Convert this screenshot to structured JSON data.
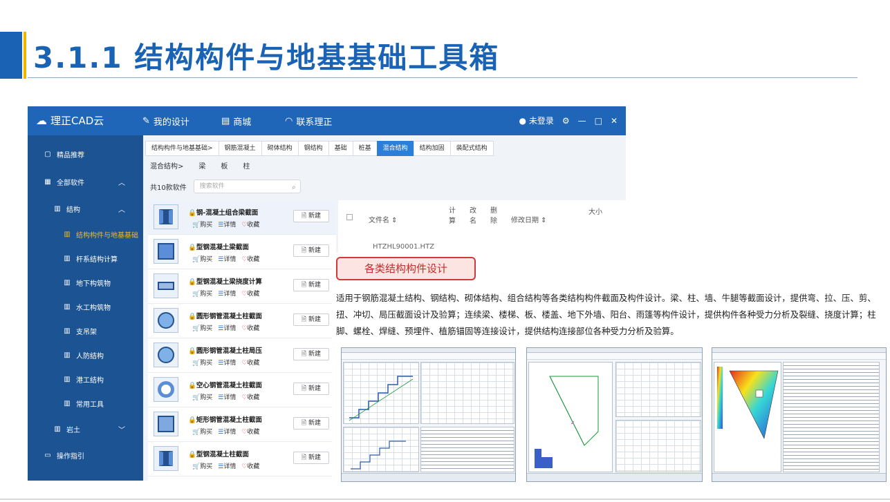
{
  "slide": {
    "title": "3.1.1 结构构件与地基基础工具箱"
  },
  "app": {
    "logo_text": "理正CAD云",
    "nav": [
      {
        "label": "我的设计"
      },
      {
        "label": "商城"
      },
      {
        "label": "联系理正"
      }
    ],
    "login_label": "未登录",
    "sidebar": [
      {
        "label": "精品推荐"
      },
      {
        "label": "全部软件"
      },
      {
        "label": "结构"
      },
      {
        "label": "结构构件与地基基础"
      },
      {
        "label": "杆系结构计算"
      },
      {
        "label": "地下构筑物"
      },
      {
        "label": "水工构筑物"
      },
      {
        "label": "支吊架"
      },
      {
        "label": "人防结构"
      },
      {
        "label": "港工结构"
      },
      {
        "label": "常用工具"
      },
      {
        "label": "岩土"
      },
      {
        "label": "操作指引"
      }
    ],
    "tabs": [
      "结构构件与地基基础>",
      "钢筋混凝土",
      "砌体结构",
      "钢结构",
      "基础",
      "桩基",
      "混合结构",
      "结构加固",
      "装配式结构"
    ],
    "crumbs": [
      "混合结构>",
      "梁",
      "板",
      "柱"
    ],
    "count_label": "共10款软件",
    "search_placeholder": "搜索软件",
    "actions": {
      "buy": "购买",
      "detail": "详情",
      "fav": "收藏",
      "new": "新建"
    },
    "items": [
      {
        "name": "钢-混凝土组合梁截面"
      },
      {
        "name": "型钢混凝土梁截面"
      },
      {
        "name": "型钢混凝土梁挠度计算"
      },
      {
        "name": "圆形钢管混凝土柱截面"
      },
      {
        "name": "圆形钢管混凝土柱局压"
      },
      {
        "name": "空心钢管混凝土柱截面"
      },
      {
        "name": "矩形钢管混凝土柱截面"
      },
      {
        "name": "型钢混凝土柱截面"
      }
    ],
    "table": {
      "col_filename": "文件名 ⇕",
      "col_calc": "计算",
      "col_modify": "改名",
      "col_delete": "删除",
      "col_date": "修改日期 ⇕",
      "col_size": "大小",
      "row1": "HTZHL90001.HTZ"
    }
  },
  "callout": {
    "label": "各类结构构件设计",
    "description": "适用于钢筋混凝土结构、钢结构、砌体结构、组合结构等各类结构构件截面及构件设计。梁、柱、墙、牛腿等截面设计，提供弯、拉、压、剪、扭、冲切、局压截面设计及验算；连续梁、楼梯、板、楼盖、地下外墙、阳台、雨篷等构件设计，提供构件各种受力分析及裂缝、挠度计算；柱脚、螺栓、焊缝、预埋件、植筋锚固等连接设计，提供结构连接部位各种受力分析及验算。"
  },
  "colors": {
    "title_blue": "#1a63b4",
    "accent_yellow": "#f0b400",
    "active_tab": "#2b7fd8",
    "callout_red": "#c42b2b"
  }
}
